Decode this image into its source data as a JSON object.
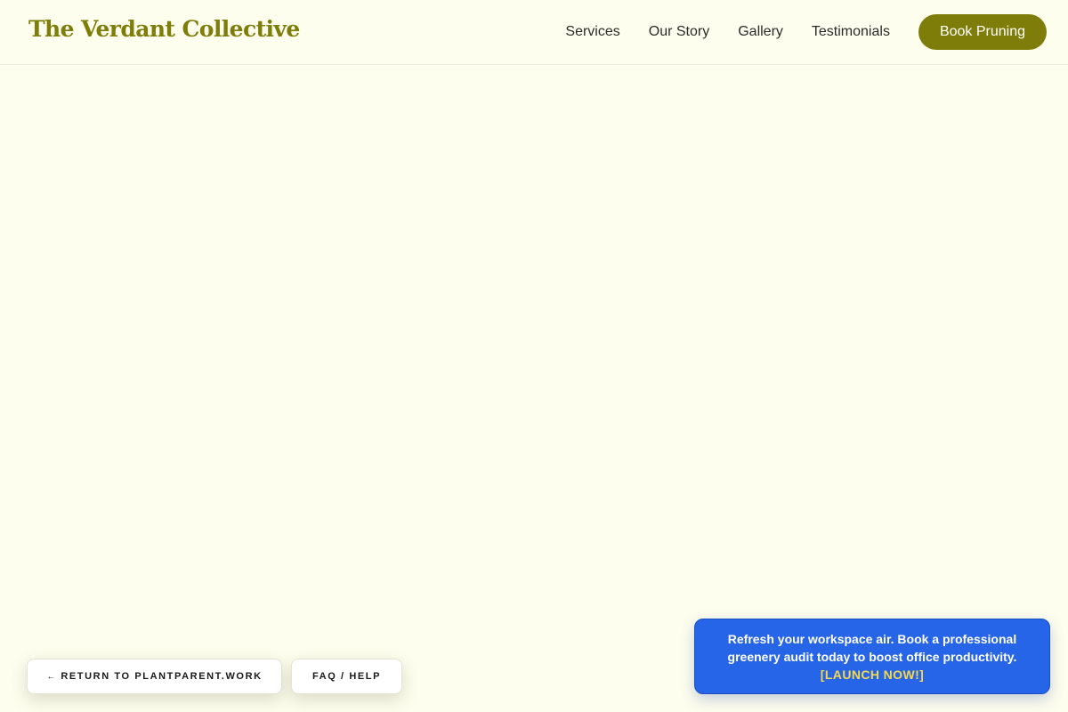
{
  "header": {
    "brand": "The Verdant Collective",
    "nav": [
      {
        "label": "Services"
      },
      {
        "label": "Our Story"
      },
      {
        "label": "Gallery"
      },
      {
        "label": "Testimonials"
      }
    ],
    "cta_label": "Book Pruning"
  },
  "footer_buttons": {
    "return_arrow": "←",
    "return_label": "RETURN TO PLANTPARENT.WORK",
    "faq_label": "FAQ / HELP"
  },
  "promo": {
    "text": "Refresh your workspace air. Book a professional greenery audit today to boost office productivity.",
    "launch_label": "[LAUNCH NOW!]"
  },
  "colors": {
    "background": "#fefeee",
    "brand": "#7f7d09",
    "promo_bg": "#2664e8",
    "promo_launch": "#f6d94a"
  }
}
